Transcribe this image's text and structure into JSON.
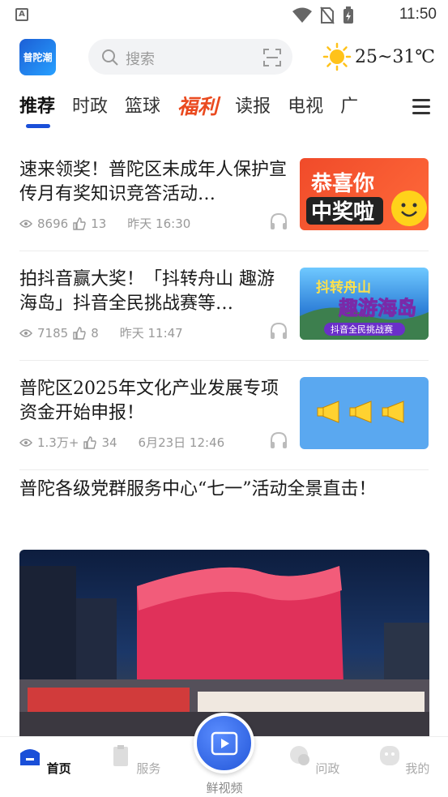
{
  "status": {
    "time": "11:50",
    "badge": "A"
  },
  "header": {
    "logo_text": "普陀潮",
    "search_placeholder": "搜索",
    "weather": "25~31℃"
  },
  "tabs": [
    "推荐",
    "时政",
    "篮球",
    "福利",
    "读报",
    "电视",
    "广"
  ],
  "feed": [
    {
      "title": "速来领奖！普陀区未成年人保护宣传月有奖知识竞答活动…",
      "views": "8696",
      "likes": "13",
      "time": "昨天  16:30",
      "thumb_text": "恭喜你中奖啦"
    },
    {
      "title": "拍抖音赢大奖！「抖转舟山 趣游海岛」抖音全民挑战赛等…",
      "views": "7185",
      "likes": "8",
      "time": "昨天  11:47",
      "thumb_text": "抖转舟山 趣游海岛 抖音全民挑战赛"
    },
    {
      "title": "普陀区2025年文化产业发展专项资金开始申报！",
      "views": "1.3万+",
      "likes": "34",
      "time": "6月23日  12:46",
      "thumb_text": ""
    }
  ],
  "big_item": {
    "title": "普陀各级党群服务中心“七一”活动全景直击！"
  },
  "bottom_nav": {
    "home": "首页",
    "service": "服务",
    "video": "鲜视频",
    "ask": "问政",
    "mine": "我的"
  },
  "colors": {
    "accent": "#1a4fd8",
    "fuli": "#ea4a1f"
  }
}
